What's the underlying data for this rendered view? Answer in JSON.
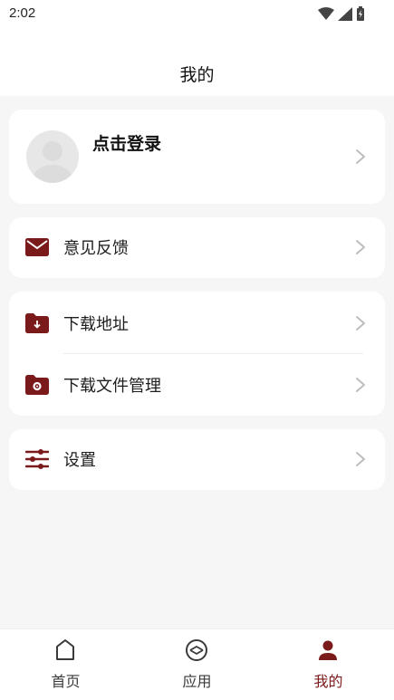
{
  "status_bar": {
    "time": "2:02"
  },
  "header": {
    "title": "我的"
  },
  "profile": {
    "login_label": "点击登录"
  },
  "menu": {
    "feedback_label": "意见反馈",
    "download_address_label": "下载地址",
    "download_manage_label": "下载文件管理",
    "settings_label": "设置"
  },
  "tabs": [
    {
      "label": "首页",
      "icon": "home-icon",
      "active": false
    },
    {
      "label": "应用",
      "icon": "apps-icon",
      "active": false
    },
    {
      "label": "我的",
      "icon": "profile-icon",
      "active": true
    }
  ],
  "colors": {
    "accent": "#7b1a1a",
    "inactive": "#3a3a3a",
    "background": "#f6f6f6",
    "card": "#ffffff"
  }
}
